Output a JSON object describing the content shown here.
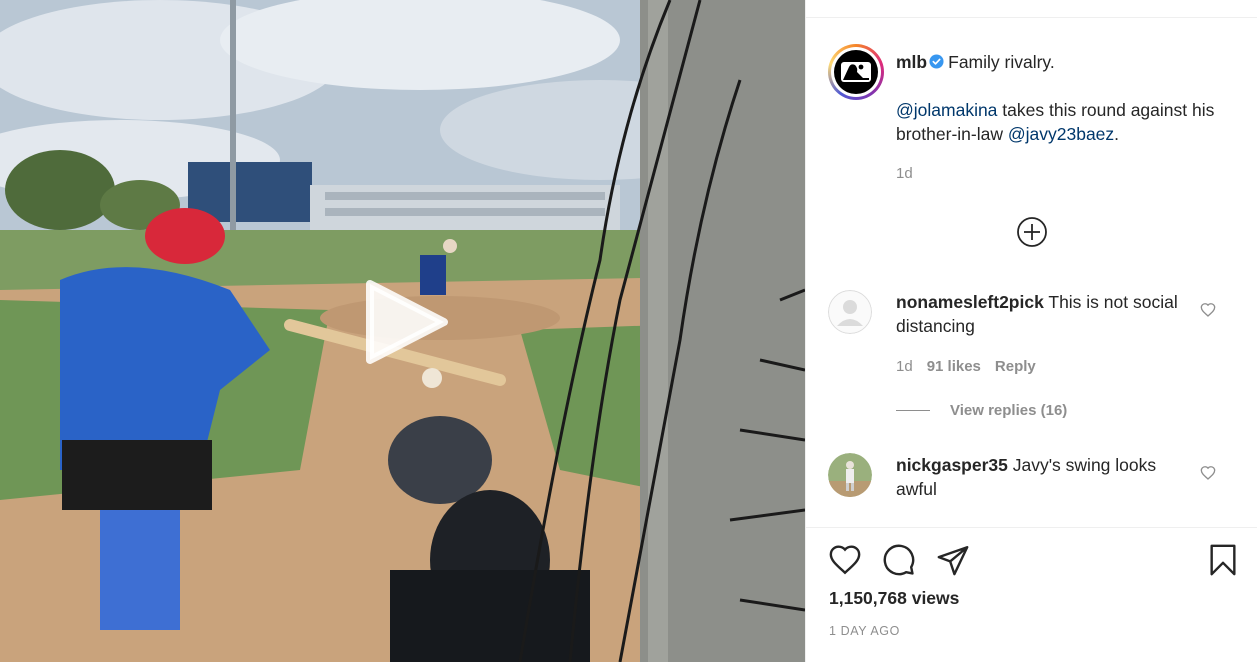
{
  "post": {
    "username": "mlb",
    "caption_line1": "Family rivalry.",
    "mention1": "@jolamakina",
    "caption_mid": " takes this round against his brother-in-law ",
    "mention2": "@javy23baez",
    "caption_end": ".",
    "time": "1d",
    "avatar_icon": "mlb-logo-icon",
    "verified_icon": "verified-badge-icon"
  },
  "comments": [
    {
      "username": "nonamesleft2pick",
      "text": " This is not social distancing",
      "time": "1d",
      "likes": "91 likes",
      "reply": "Reply",
      "view_replies": "View replies (16)"
    },
    {
      "username": "nickgasper35",
      "text": " Javy's swing looks awful"
    }
  ],
  "footer": {
    "views": "1,150,768 views",
    "ago": "1 DAY AGO"
  },
  "icons": {
    "like": "heart-icon",
    "comment": "comment-icon",
    "share": "share-icon",
    "save": "bookmark-icon",
    "play": "play-icon",
    "load_more": "plus-circle-icon"
  },
  "colors": {
    "mention": "#00376b",
    "muted": "#8e8e8e",
    "verified": "#3897f0"
  }
}
